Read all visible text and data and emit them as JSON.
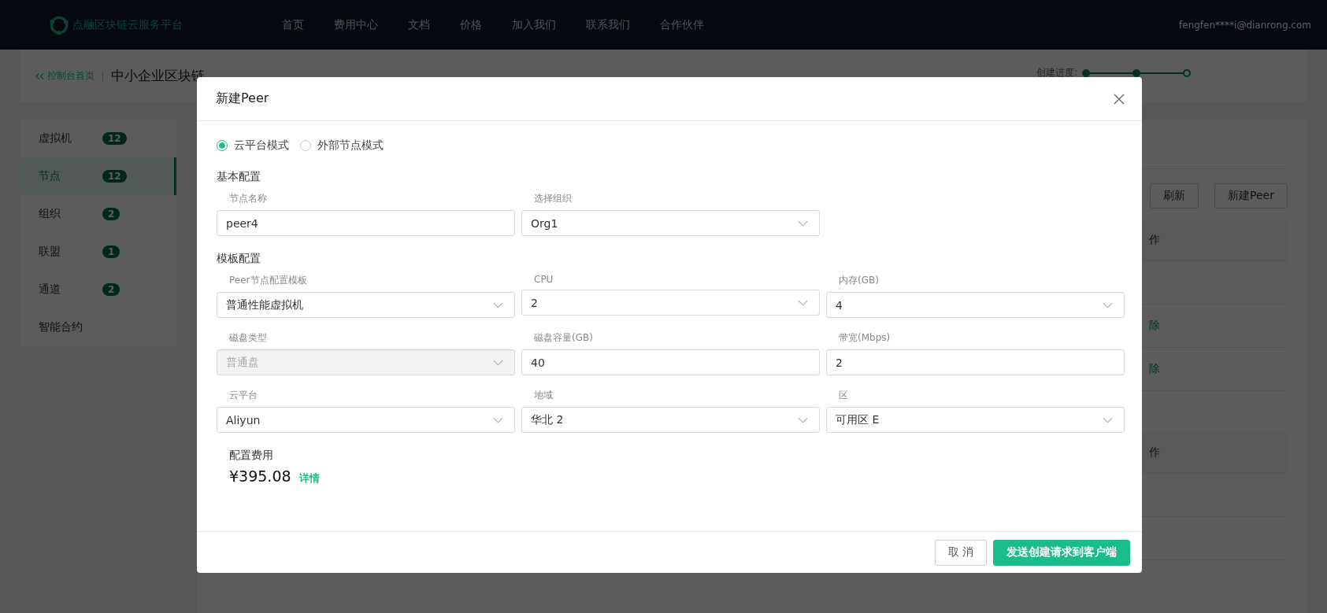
{
  "nav": {
    "brand": "点融区块链云服务平台",
    "links": [
      "首页",
      "费用中心",
      "文档",
      "价格",
      "加入我们",
      "联系我们",
      "合作伙伴"
    ],
    "user": "fengfen****i@dianrong.com"
  },
  "breadcrumb": {
    "back": "控制台首页",
    "title": "中小企业区块链"
  },
  "progress": {
    "label": "创建进度:",
    "steps": [
      {
        "done": true
      },
      {
        "done": true
      },
      {
        "done": false
      }
    ]
  },
  "sidebar": {
    "items": [
      {
        "label": "虚拟机",
        "count": "12",
        "selected": false
      },
      {
        "label": "节点",
        "count": "12",
        "selected": true
      },
      {
        "label": "组织",
        "count": "2",
        "selected": false
      },
      {
        "label": "联盟",
        "count": "1",
        "selected": false
      },
      {
        "label": "通道",
        "count": "2",
        "selected": false
      },
      {
        "label": "智能合约",
        "selected": false
      }
    ]
  },
  "toolbar": {
    "buttons": [
      "刷新",
      "新建Peer"
    ]
  },
  "tables": [
    {
      "action_header": "作",
      "rows": [
        {},
        {
          "action": "除"
        },
        {
          "action": "除"
        }
      ]
    },
    {
      "action_header": "作",
      "rows": [
        {},
        {}
      ]
    }
  ],
  "modal": {
    "title": "新建Peer",
    "modes": [
      {
        "label": "云平台模式",
        "selected": true
      },
      {
        "label": "外部节点模式",
        "selected": false
      }
    ],
    "sections": [
      {
        "title": "基本配置",
        "fields": [
          {
            "label": "节点名称",
            "kind": "input",
            "value": "peer4",
            "disabled": false
          },
          {
            "label": "选择组织",
            "kind": "select",
            "value": "Org1",
            "disabled": false
          }
        ]
      },
      {
        "title": "模板配置",
        "fields": [
          {
            "label": "Peer节点配置模板",
            "kind": "select",
            "value": "普通性能虚拟机",
            "disabled": false
          },
          {
            "label": "CPU",
            "kind": "select",
            "value": "2",
            "disabled": false
          },
          {
            "label": "内存(GB)",
            "kind": "select",
            "value": "4",
            "disabled": false
          },
          {
            "label": "磁盘类型",
            "kind": "select",
            "value": "普通盘",
            "disabled": true
          },
          {
            "label": "磁盘容量(GB)",
            "kind": "input",
            "value": "40",
            "disabled": false
          },
          {
            "label": "带宽(Mbps)",
            "kind": "input",
            "value": "2",
            "disabled": false
          },
          {
            "label": "云平台",
            "kind": "select",
            "value": "Aliyun",
            "disabled": false
          },
          {
            "label": "地域",
            "kind": "select",
            "value": "华北 2",
            "disabled": false
          },
          {
            "label": "区",
            "kind": "select",
            "value": "可用区 E",
            "disabled": false
          }
        ]
      }
    ],
    "cost": {
      "label": "配置费用",
      "amount": "¥395.08",
      "link": "详情"
    },
    "buttons": [
      {
        "label": "取 消",
        "kind": "secondary"
      },
      {
        "label": "发送创建请求到客户端",
        "kind": "primary"
      }
    ]
  }
}
